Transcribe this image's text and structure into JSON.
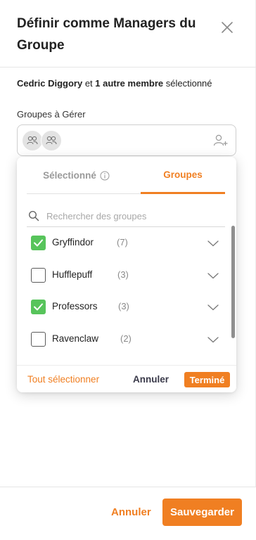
{
  "dialog": {
    "title": "Définir comme Managers du Groupe",
    "close_icon": "close-icon"
  },
  "selection": {
    "member_name": "Cedric Diggory",
    "joiner": "et",
    "others": "1 autre membre",
    "suffix": "sélectionné"
  },
  "groups_field": {
    "label": "Groupes à Gérer",
    "avatar_icon": "group-icon",
    "add_icon": "add-user-icon"
  },
  "dropdown": {
    "tabs": [
      {
        "label": "Sélectionné",
        "icon": "info-icon",
        "active": false
      },
      {
        "label": "Groupes",
        "active": true
      }
    ],
    "search": {
      "placeholder": "Rechercher des groupes",
      "value": ""
    },
    "groups": [
      {
        "name": "Gryffindor",
        "count": "(7)",
        "checked": true
      },
      {
        "name": "Hufflepuff",
        "count": "(3)",
        "checked": false
      },
      {
        "name": "Professors",
        "count": "(3)",
        "checked": true
      },
      {
        "name": "Ravenclaw",
        "count": "(2)",
        "checked": false
      }
    ],
    "select_all_label": "Tout sélectionner",
    "cancel_label": "Annuler",
    "done_label": "Terminé"
  },
  "footer": {
    "cancel_label": "Annuler",
    "save_label": "Sauvegarder"
  },
  "colors": {
    "accent": "#f07f22",
    "check": "#57c45b"
  }
}
